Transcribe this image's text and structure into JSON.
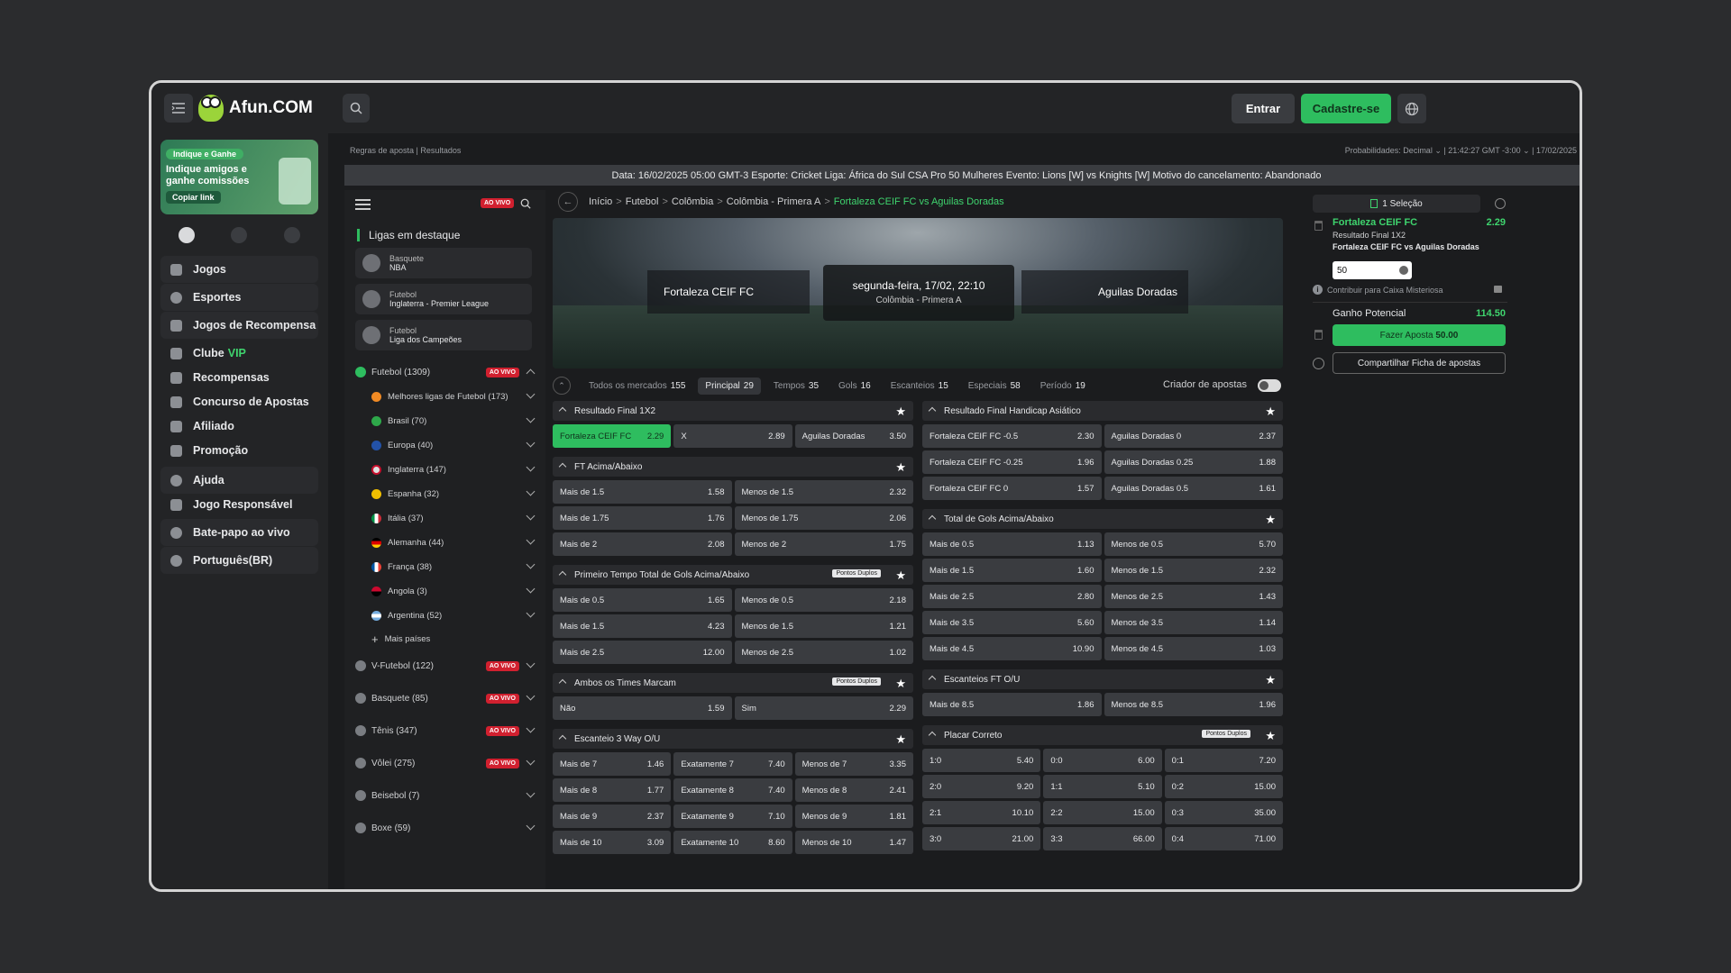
{
  "header": {
    "logo_text": "Afun.COM",
    "login_label": "Entrar",
    "signup_label": "Cadastre-se"
  },
  "promo": {
    "tag": "Indique e Ganhe",
    "text": "Indique amigos e ganhe comissões",
    "copy_label": "Copiar link"
  },
  "nav": {
    "items": [
      "Jogos",
      "Esportes",
      "Jogos de Recompensa",
      "Clube",
      "Recompensas",
      "Concurso de Apostas",
      "Afiliado",
      "Promoção",
      "Ajuda",
      "Jogo Responsável",
      "Bate-papo ao vivo",
      "Português(BR)"
    ],
    "vip": "VIP"
  },
  "top": {
    "links": "Regras de aposta | Resultados",
    "probs": "Probabilidades: Decimal ⌄  | 21:42:27 GMT -3:00 ⌄  | 17/02/2025",
    "cancel": "Data: 16/02/2025 05:00 GMT-3 Esporte: Cricket Liga: África do Sul CSA Pro 50 Mulheres Evento: Lions [W] vs Knights [W] Motivo do cancelamento: Abandonado"
  },
  "sports": {
    "live": "AO VIVO",
    "featured_title": "Ligas em destaque",
    "featured": [
      {
        "sport": "Basquete",
        "league": "NBA"
      },
      {
        "sport": "Futebol",
        "league": "Inglaterra - Premier League"
      },
      {
        "sport": "Futebol",
        "league": "Liga dos Campeões"
      }
    ],
    "futebol": "Futebol  (1309)",
    "subs": [
      "Melhores ligas de Futebol (173)",
      "Brasil (70)",
      "Europa (40)",
      "Inglaterra (147)",
      "Espanha (32)",
      "Itália (37)",
      "Alemanha (44)",
      "França (38)",
      "Angola (3)",
      "Argentina (52)"
    ],
    "more": "Mais países",
    "others": [
      "V-Futebol  (122)",
      "Basquete  (85)",
      "Tênis  (347)",
      "Vôlei  (275)",
      "Beisebol  (7)",
      "Boxe  (59)"
    ]
  },
  "breadcrumb": [
    "Início",
    "Futebol",
    "Colômbia",
    "Colômbia - Primera A",
    "Fortaleza CEIF FC vs Aguilas Doradas"
  ],
  "match": {
    "home": "Fortaleza CEIF FC",
    "away": "Aguilas Doradas",
    "date": "segunda-feira, 17/02, 22:10",
    "competition": "Colômbia - Primera A"
  },
  "tabs": [
    {
      "label": "Todos os mercados",
      "count": "155"
    },
    {
      "label": "Principal",
      "count": "29"
    },
    {
      "label": "Tempos",
      "count": "35"
    },
    {
      "label": "Gols",
      "count": "16"
    },
    {
      "label": "Escanteios",
      "count": "15"
    },
    {
      "label": "Especiais",
      "count": "58"
    },
    {
      "label": "Período",
      "count": "19"
    }
  ],
  "builder_label": "Criador de apostas",
  "double_points": "Pontos Duplos",
  "markets_left": [
    {
      "title": "Resultado Final 1X2",
      "pd": false,
      "cols": 3,
      "rows": [
        [
          [
            "Fortaleza CEIF FC",
            "2.29"
          ],
          [
            "X",
            "2.89"
          ],
          [
            "Aguilas Doradas",
            "3.50"
          ]
        ]
      ]
    },
    {
      "title": "FT Acima/Abaixo",
      "pd": false,
      "cols": 2,
      "rows": [
        [
          [
            "Mais de 1.5",
            "1.58"
          ],
          [
            "Menos de 1.5",
            "2.32"
          ]
        ],
        [
          [
            "Mais de 1.75",
            "1.76"
          ],
          [
            "Menos de 1.75",
            "2.06"
          ]
        ],
        [
          [
            "Mais de 2",
            "2.08"
          ],
          [
            "Menos de 2",
            "1.75"
          ]
        ]
      ]
    },
    {
      "title": "Primeiro Tempo Total de Gols Acima/Abaixo",
      "pd": true,
      "cols": 2,
      "rows": [
        [
          [
            "Mais de 0.5",
            "1.65"
          ],
          [
            "Menos de 0.5",
            "2.18"
          ]
        ],
        [
          [
            "Mais de 1.5",
            "4.23"
          ],
          [
            "Menos de 1.5",
            "1.21"
          ]
        ],
        [
          [
            "Mais de 2.5",
            "12.00"
          ],
          [
            "Menos de 2.5",
            "1.02"
          ]
        ]
      ]
    },
    {
      "title": "Ambos os Times Marcam",
      "pd": true,
      "cols": 2,
      "rows": [
        [
          [
            "Não",
            "1.59"
          ],
          [
            "Sim",
            "2.29"
          ]
        ]
      ]
    },
    {
      "title": "Escanteio 3 Way O/U",
      "pd": false,
      "cols": 3,
      "rows": [
        [
          [
            "Mais de 7",
            "1.46"
          ],
          [
            "Exatamente 7",
            "7.40"
          ],
          [
            "Menos de 7",
            "3.35"
          ]
        ],
        [
          [
            "Mais de 8",
            "1.77"
          ],
          [
            "Exatamente 8",
            "7.40"
          ],
          [
            "Menos de 8",
            "2.41"
          ]
        ],
        [
          [
            "Mais de 9",
            "2.37"
          ],
          [
            "Exatamente 9",
            "7.10"
          ],
          [
            "Menos de 9",
            "1.81"
          ]
        ],
        [
          [
            "Mais de 10",
            "3.09"
          ],
          [
            "Exatamente 10",
            "8.60"
          ],
          [
            "Menos de 10",
            "1.47"
          ]
        ]
      ]
    }
  ],
  "markets_right": [
    {
      "title": "Resultado Final Handicap Asiático",
      "pd": false,
      "cols": 2,
      "rows": [
        [
          [
            "Fortaleza CEIF FC -0.5",
            "2.30"
          ],
          [
            "Aguilas Doradas 0",
            "2.37"
          ]
        ],
        [
          [
            "Fortaleza CEIF FC -0.25",
            "1.96"
          ],
          [
            "Aguilas Doradas 0.25",
            "1.88"
          ]
        ],
        [
          [
            "Fortaleza CEIF FC 0",
            "1.57"
          ],
          [
            "Aguilas Doradas 0.5",
            "1.61"
          ]
        ]
      ]
    },
    {
      "title": "Total de Gols Acima/Abaixo",
      "pd": false,
      "cols": 2,
      "rows": [
        [
          [
            "Mais de 0.5",
            "1.13"
          ],
          [
            "Menos de 0.5",
            "5.70"
          ]
        ],
        [
          [
            "Mais de 1.5",
            "1.60"
          ],
          [
            "Menos de 1.5",
            "2.32"
          ]
        ],
        [
          [
            "Mais de 2.5",
            "2.80"
          ],
          [
            "Menos de 2.5",
            "1.43"
          ]
        ],
        [
          [
            "Mais de 3.5",
            "5.60"
          ],
          [
            "Menos de 3.5",
            "1.14"
          ]
        ],
        [
          [
            "Mais de 4.5",
            "10.90"
          ],
          [
            "Menos de 4.5",
            "1.03"
          ]
        ]
      ]
    },
    {
      "title": "Escanteios FT O/U",
      "pd": false,
      "cols": 2,
      "rows": [
        [
          [
            "Mais de 8.5",
            "1.86"
          ],
          [
            "Menos de 8.5",
            "1.96"
          ]
        ]
      ]
    },
    {
      "title": "Placar Correto",
      "pd": true,
      "cols": 3,
      "rows": [
        [
          [
            "1:0",
            "5.40"
          ],
          [
            "0:0",
            "6.00"
          ],
          [
            "0:1",
            "7.20"
          ]
        ],
        [
          [
            "2:0",
            "9.20"
          ],
          [
            "1:1",
            "5.10"
          ],
          [
            "0:2",
            "15.00"
          ]
        ],
        [
          [
            "2:1",
            "10.10"
          ],
          [
            "2:2",
            "15.00"
          ],
          [
            "0:3",
            "35.00"
          ]
        ],
        [
          [
            "3:0",
            "21.00"
          ],
          [
            "3:3",
            "66.00"
          ],
          [
            "0:4",
            "71.00"
          ]
        ]
      ]
    }
  ],
  "slip": {
    "header": "1 Seleção",
    "pick": "Fortaleza CEIF FC",
    "odds": "2.29",
    "market": "Resultado Final 1X2",
    "event": "Fortaleza CEIF FC vs Aguilas Doradas",
    "stake": "50",
    "mystery": "Contribuir para Caixa Misteriosa",
    "potential_label": "Ganho Potencial",
    "potential_value": "114.50",
    "place_label": "Fazer Aposta",
    "place_value": "50.00",
    "share_label": "Compartilhar Ficha de apostas"
  }
}
